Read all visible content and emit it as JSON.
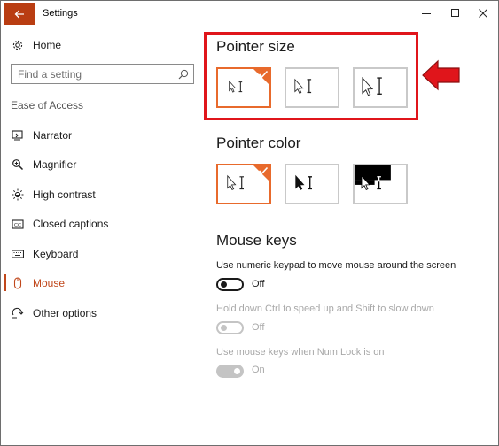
{
  "window": {
    "title": "Settings",
    "controls": [
      "minimize-icon",
      "maximize-icon",
      "close-icon"
    ]
  },
  "sidebar": {
    "home_label": "Home",
    "search_placeholder": "Find a setting",
    "section_label": "Ease of Access",
    "items": [
      {
        "label": "Narrator",
        "icon": "narrator-icon"
      },
      {
        "label": "Magnifier",
        "icon": "magnifier-icon"
      },
      {
        "label": "High contrast",
        "icon": "high-contrast-icon"
      },
      {
        "label": "Closed captions",
        "icon": "closed-captions-icon"
      },
      {
        "label": "Keyboard",
        "icon": "keyboard-icon"
      },
      {
        "label": "Mouse",
        "icon": "mouse-icon",
        "active": true
      },
      {
        "label": "Other options",
        "icon": "other-options-icon"
      }
    ]
  },
  "content": {
    "pointer_size": {
      "title": "Pointer size",
      "options": [
        "small",
        "medium",
        "large"
      ],
      "selected_index": 0
    },
    "pointer_color": {
      "title": "Pointer color",
      "options": [
        "white",
        "black",
        "inverted"
      ],
      "selected_index": 0
    },
    "mouse_keys": {
      "title": "Mouse keys",
      "settings": [
        {
          "description": "Use numeric keypad to move mouse around the screen",
          "state_label": "Off",
          "enabled": true
        },
        {
          "description": "Hold down Ctrl to speed up and Shift to slow down",
          "state_label": "Off",
          "enabled": false
        },
        {
          "description": "Use mouse keys when Num Lock is on",
          "state_label": "On",
          "enabled": false
        }
      ]
    }
  },
  "colors": {
    "accent": "#e86a2c",
    "back_button": "#b93d12",
    "annotation": "#e0151b"
  }
}
